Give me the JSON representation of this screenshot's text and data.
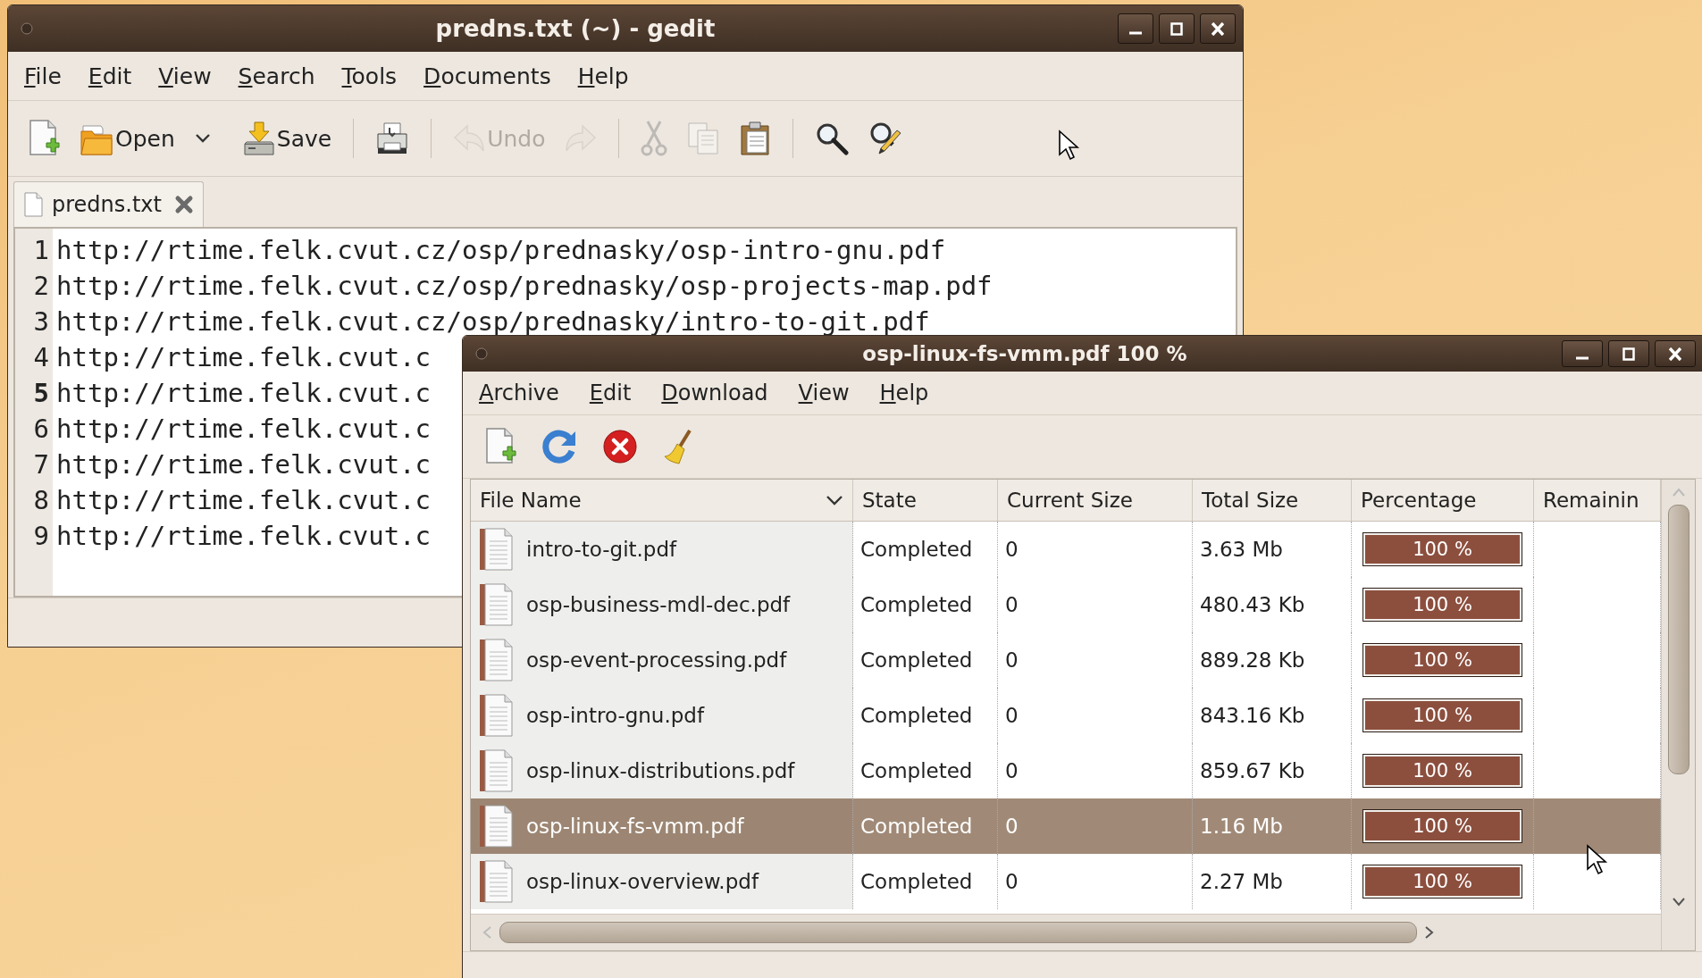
{
  "gedit": {
    "title": "predns.txt (~) - gedit",
    "menu": [
      "File",
      "Edit",
      "View",
      "Search",
      "Tools",
      "Documents",
      "Help"
    ],
    "toolbar_groups": [
      {
        "items": [
          {
            "kind": "new",
            "disabled": false
          },
          {
            "kind": "open",
            "label": "Open",
            "disabled": false
          },
          {
            "kind": "dropdown",
            "disabled": false
          },
          {
            "kind": "save",
            "label": "Save",
            "disabled": false
          }
        ]
      },
      {
        "items": [
          {
            "kind": "print",
            "disabled": false
          }
        ]
      },
      {
        "items": [
          {
            "kind": "undo",
            "label": "Undo",
            "disabled": true
          },
          {
            "kind": "redo",
            "disabled": true
          }
        ]
      },
      {
        "items": [
          {
            "kind": "cut",
            "disabled": true
          },
          {
            "kind": "copy",
            "disabled": true
          },
          {
            "kind": "paste",
            "disabled": false
          }
        ]
      },
      {
        "items": [
          {
            "kind": "find",
            "disabled": false
          },
          {
            "kind": "replace",
            "disabled": false
          }
        ]
      }
    ],
    "tabs": [
      {
        "label": "predns.txt",
        "selected": true
      }
    ],
    "lines": [
      {
        "number": "1",
        "text": "http://rtime.felk.cvut.cz/osp/prednasky/osp-intro-gnu.pdf",
        "current": false
      },
      {
        "number": "2",
        "text": "http://rtime.felk.cvut.cz/osp/prednasky/osp-projects-map.pdf",
        "current": false
      },
      {
        "number": "3",
        "text": "http://rtime.felk.cvut.cz/osp/prednasky/intro-to-git.pdf",
        "current": false
      },
      {
        "number": "4",
        "text": "http://rtime.felk.cvut.c",
        "current": false
      },
      {
        "number": "5",
        "text": "http://rtime.felk.cvut.c",
        "current": true
      },
      {
        "number": "6",
        "text": "http://rtime.felk.cvut.c",
        "current": false
      },
      {
        "number": "7",
        "text": "http://rtime.felk.cvut.c",
        "current": false
      },
      {
        "number": "8",
        "text": "http://rtime.felk.cvut.c",
        "current": false
      },
      {
        "number": "9",
        "text": "http://rtime.felk.cvut.c",
        "current": false
      }
    ]
  },
  "downloader": {
    "title": "osp-linux-fs-vmm.pdf 100 %",
    "menu": [
      "Archive",
      "Edit",
      "Download",
      "View",
      "Help"
    ],
    "toolbar_groups": [
      {
        "items": [
          {
            "kind": "add",
            "disabled": false
          },
          {
            "kind": "refresh",
            "disabled": false
          },
          {
            "kind": "cancel",
            "disabled": false
          },
          {
            "kind": "clean",
            "disabled": false
          }
        ]
      }
    ],
    "columns": [
      {
        "label": "File Name",
        "sorted": true
      },
      {
        "label": "State",
        "sorted": false
      },
      {
        "label": "Current Size",
        "sorted": false
      },
      {
        "label": "Total Size",
        "sorted": false
      },
      {
        "label": "Percentage",
        "sorted": false
      },
      {
        "label": "Remainin",
        "sorted": false
      }
    ],
    "rows": [
      {
        "file_name": "intro-to-git.pdf",
        "state": "Completed",
        "current_size": "0",
        "total_size": "3.63 Mb",
        "percentage": "100 %",
        "level": 1,
        "selected": false
      },
      {
        "file_name": "osp-business-mdl-dec.pdf",
        "state": "Completed",
        "current_size": "0",
        "total_size": "480.43 Kb",
        "percentage": "100 %",
        "level": 1,
        "selected": false
      },
      {
        "file_name": "osp-event-processing.pdf",
        "state": "Completed",
        "current_size": "0",
        "total_size": "889.28 Kb",
        "percentage": "100 %",
        "level": 1,
        "selected": false
      },
      {
        "file_name": "osp-intro-gnu.pdf",
        "state": "Completed",
        "current_size": "0",
        "total_size": "843.16 Kb",
        "percentage": "100 %",
        "level": 1,
        "selected": false
      },
      {
        "file_name": "osp-linux-distributions.pdf",
        "state": "Completed",
        "current_size": "0",
        "total_size": "859.67 Kb",
        "percentage": "100 %",
        "level": 1,
        "selected": false
      },
      {
        "file_name": "osp-linux-fs-vmm.pdf",
        "state": "Completed",
        "current_size": "0",
        "total_size": "1.16 Mb",
        "percentage": "100 %",
        "level": 1,
        "selected": true
      },
      {
        "file_name": "osp-linux-overview.pdf",
        "state": "Completed",
        "current_size": "0",
        "total_size": "2.27 Mb",
        "percentage": "100 %",
        "level": 1,
        "selected": false
      }
    ]
  }
}
